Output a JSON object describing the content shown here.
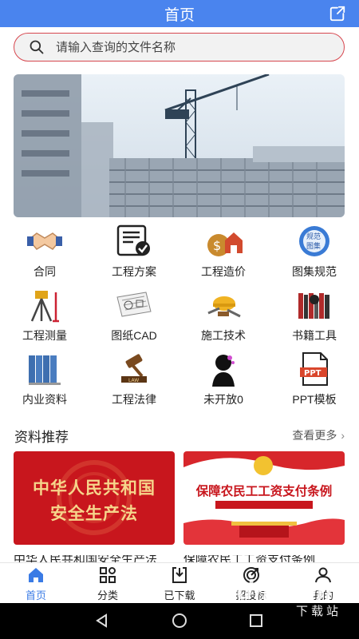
{
  "header": {
    "title": "首页"
  },
  "search": {
    "placeholder": "请输入查询的文件名称"
  },
  "categories": [
    {
      "label": "合同",
      "icon": "handshake-icon"
    },
    {
      "label": "工程方案",
      "icon": "document-check-icon"
    },
    {
      "label": "工程造价",
      "icon": "money-house-icon"
    },
    {
      "label": "图集规范",
      "icon": "standards-globe-icon"
    },
    {
      "label": "工程测量",
      "icon": "survey-tripod-icon"
    },
    {
      "label": "图纸CAD",
      "icon": "cad-drawing-icon"
    },
    {
      "label": "施工技术",
      "icon": "construction-tools-icon"
    },
    {
      "label": "书籍工具",
      "icon": "books-icon"
    },
    {
      "label": "内业资料",
      "icon": "binders-icon"
    },
    {
      "label": "工程法律",
      "icon": "gavel-icon"
    },
    {
      "label": "未开放0",
      "icon": "thinking-person-icon"
    },
    {
      "label": "PPT模板",
      "icon": "ppt-file-icon"
    }
  ],
  "recommend": {
    "title": "资料推荐",
    "more": "查看更多",
    "cards": [
      {
        "line1": "中华人民共和国",
        "line2": "安全生产法",
        "caption": "中华人民共和国安全生产法"
      },
      {
        "line1": "保障农民工工资支付条例",
        "caption": "保障农民工工资支付条例"
      }
    ]
  },
  "tabbar": [
    {
      "label": "首页",
      "icon": "home-icon",
      "active": true
    },
    {
      "label": "分类",
      "icon": "category-grid-icon",
      "active": false
    },
    {
      "label": "已下载",
      "icon": "download-icon",
      "active": false
    },
    {
      "label": "招投标",
      "icon": "bid-target-icon",
      "active": false
    },
    {
      "label": "我的",
      "icon": "user-icon",
      "active": false
    }
  ],
  "watermark": {
    "text": "下载站"
  },
  "colors": {
    "primary": "#4a84ee",
    "accent_red": "#c8161d",
    "active_tab": "#3a7be5"
  }
}
